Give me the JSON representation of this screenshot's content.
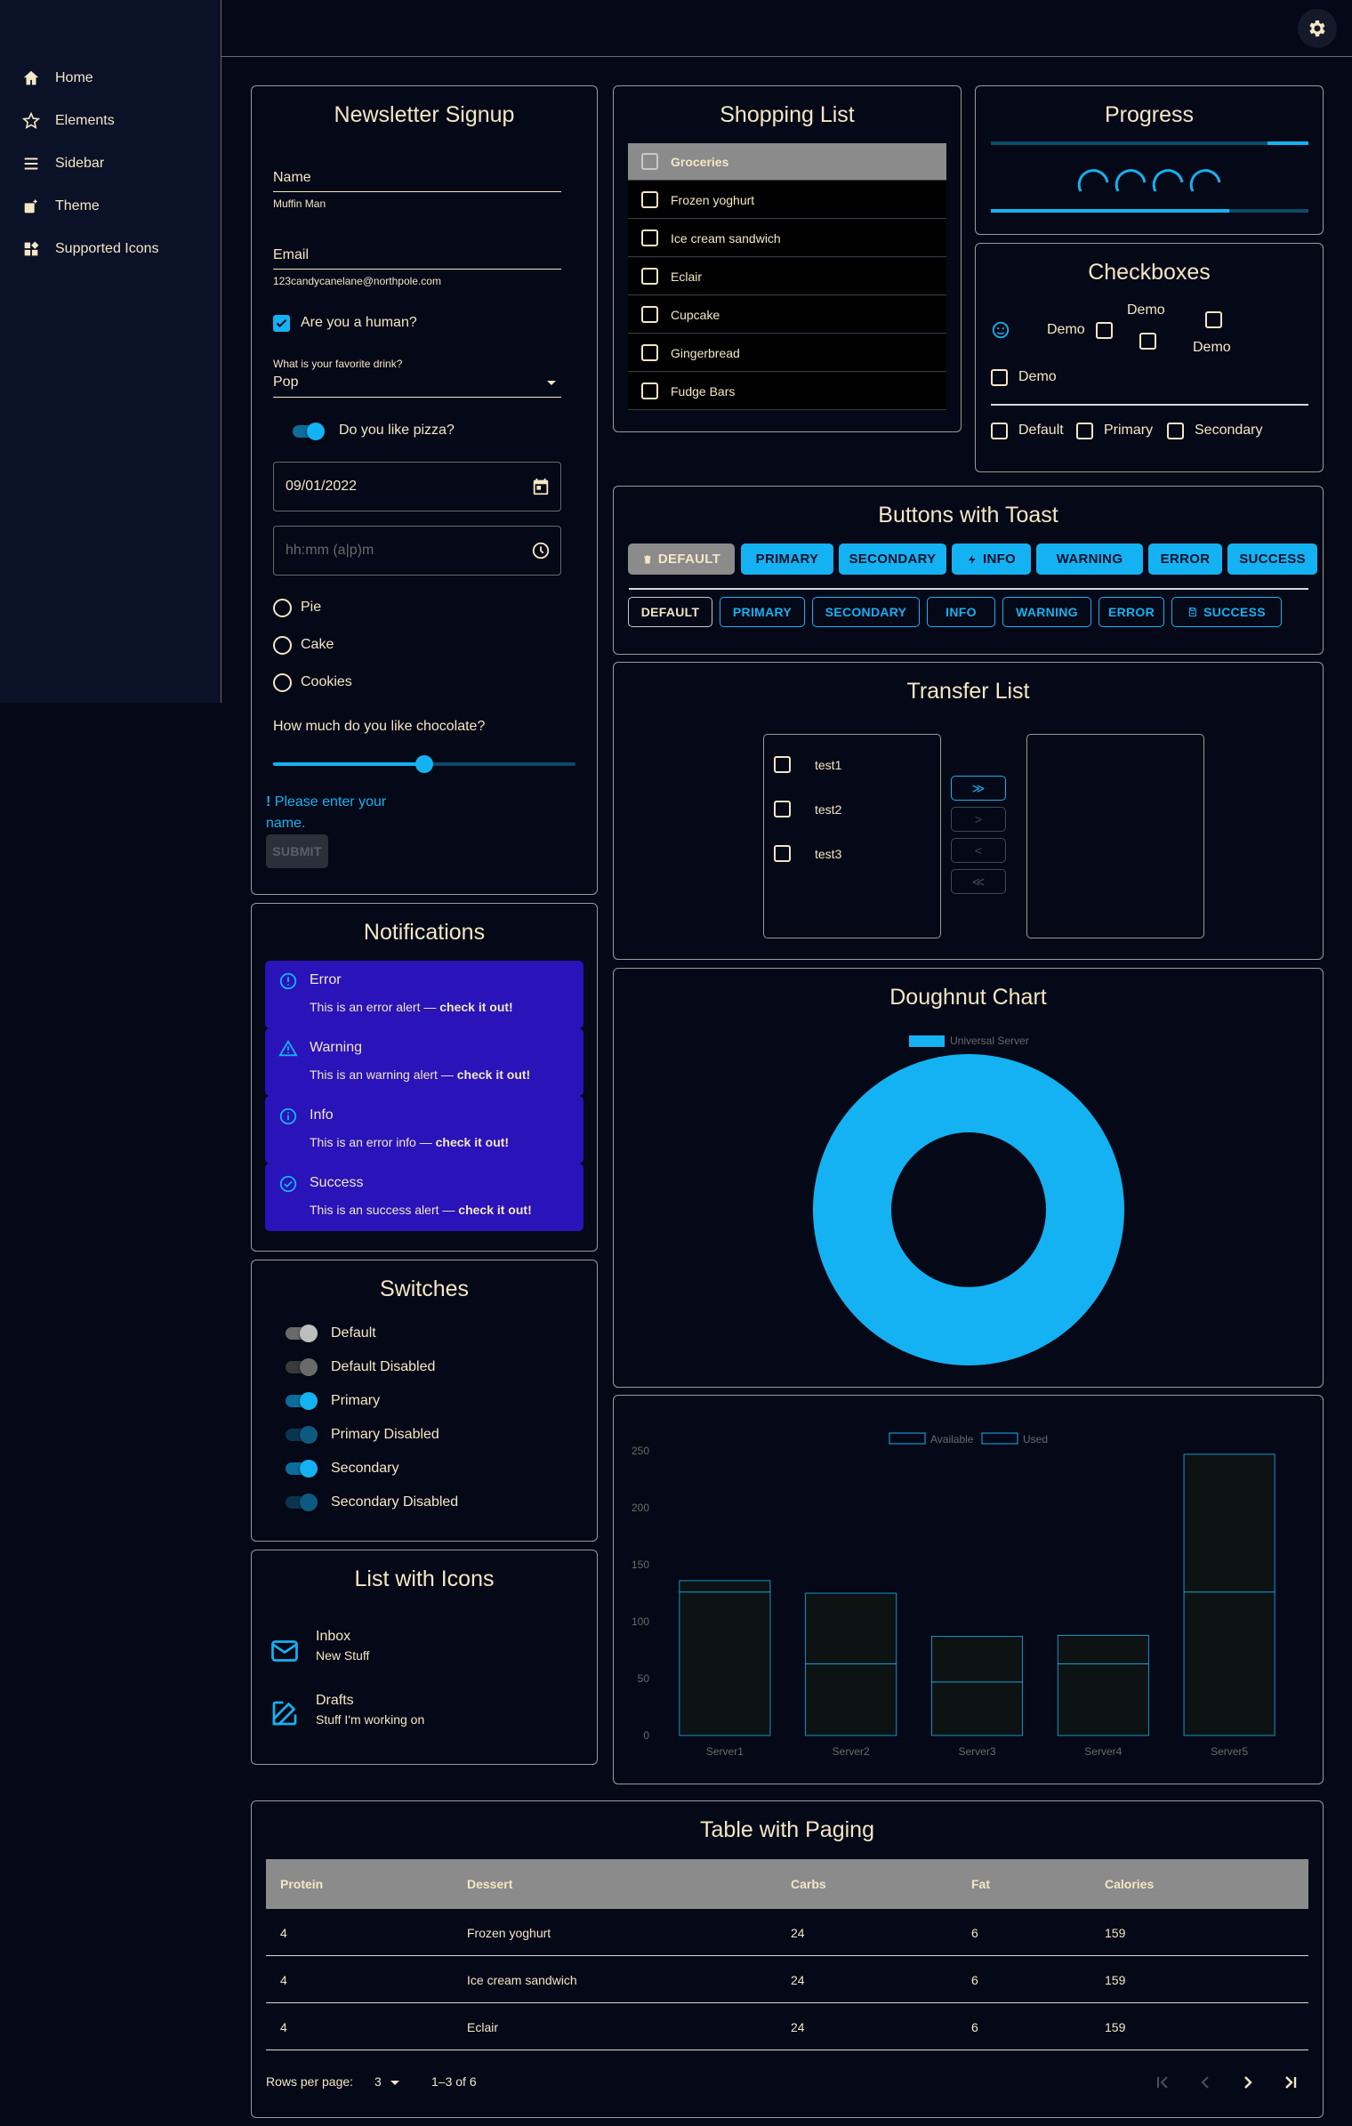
{
  "sidebar": {
    "items": [
      {
        "label": "Home",
        "icon": "home-icon"
      },
      {
        "label": "Elements",
        "icon": "star-icon"
      },
      {
        "label": "Sidebar",
        "icon": "menu-icon"
      },
      {
        "label": "Theme",
        "icon": "theme-icon"
      },
      {
        "label": "Supported Icons",
        "icon": "widgets-icon"
      }
    ]
  },
  "header": {
    "settings_icon": "gear-icon"
  },
  "newsletter": {
    "title": "Newsletter Signup",
    "name_label": "Name",
    "name_value": "Muffin Man",
    "email_label": "Email",
    "email_value": "123candycanelane@northpole.com",
    "human_label": "Are you a human?",
    "human_checked": true,
    "drink_label": "What is your favorite drink?",
    "drink_value": "Pop",
    "pizza_label": "Do you like pizza?",
    "pizza_on": true,
    "date_value": "09/01/2022",
    "time_placeholder": "hh:mm (a|p)m",
    "radios": [
      "Pie",
      "Cake",
      "Cookies"
    ],
    "slider_label": "How much do you like chocolate?",
    "slider_value": 0.5,
    "error_icon": "!",
    "error_text": "Please enter your name.",
    "submit_label": "SUBMIT"
  },
  "shopping": {
    "title": "Shopping List",
    "items": [
      "Groceries",
      "Frozen yoghurt",
      "Ice cream sandwich",
      "Eclair",
      "Cupcake",
      "Gingerbread",
      "Fudge Bars"
    ]
  },
  "progress": {
    "title": "Progress",
    "bar1_value": 0.13,
    "bar2_value": 0.75
  },
  "checkboxes": {
    "title": "Checkboxes",
    "demo": "Demo",
    "row2": [
      "Default",
      "Primary",
      "Secondary"
    ]
  },
  "buttons": {
    "title": "Buttons with Toast",
    "contained": [
      "DEFAULT",
      "PRIMARY",
      "SECONDARY",
      "INFO",
      "WARNING",
      "ERROR",
      "SUCCESS"
    ],
    "outlined": [
      "DEFAULT",
      "PRIMARY",
      "SECONDARY",
      "INFO",
      "WARNING",
      "ERROR",
      "SUCCESS"
    ]
  },
  "transfer": {
    "title": "Transfer List",
    "left": [
      "test1",
      "test2",
      "test3"
    ],
    "buttons": [
      "≫",
      ">",
      "<",
      "≪"
    ]
  },
  "notifications": {
    "title": "Notifications",
    "alerts": [
      {
        "title": "Error",
        "text": "This is an error alert — ",
        "bold": "check it out!"
      },
      {
        "title": "Warning",
        "text": "This is an warning alert — ",
        "bold": "check it out!"
      },
      {
        "title": "Info",
        "text": "This is an error info — ",
        "bold": "check it out!"
      },
      {
        "title": "Success",
        "text": "This is an success alert — ",
        "bold": "check it out!"
      }
    ]
  },
  "switches": {
    "title": "Switches",
    "items": [
      "Default",
      "Default Disabled",
      "Primary",
      "Primary Disabled",
      "Secondary",
      "Secondary Disabled"
    ]
  },
  "icon_list": {
    "title": "List with Icons",
    "items": [
      {
        "primary": "Inbox",
        "secondary": "New Stuff",
        "icon": "mail-icon"
      },
      {
        "primary": "Drafts",
        "secondary": "Stuff I'm working on",
        "icon": "edit-icon"
      }
    ]
  },
  "doughnut": {
    "title": "Doughnut Chart",
    "legend": "Universal Server",
    "color": "#14b2f2"
  },
  "table": {
    "title": "Table with Paging",
    "headers": [
      "Protein",
      "Dessert",
      "Carbs",
      "Fat",
      "Calories"
    ],
    "rows": [
      [
        "4",
        "Frozen yoghurt",
        "24",
        "6",
        "159"
      ],
      [
        "4",
        "Ice cream sandwich",
        "24",
        "6",
        "159"
      ],
      [
        "4",
        "Eclair",
        "24",
        "6",
        "159"
      ]
    ],
    "rows_per_page_label": "Rows per page:",
    "rows_per_page": "3",
    "range": "1–3 of 6"
  },
  "chart_data": [
    {
      "type": "pie",
      "categories": [
        "Universal Server"
      ],
      "values": [
        100
      ],
      "title": "Doughnut Chart"
    },
    {
      "type": "bar",
      "categories": [
        "Server1",
        "Server2",
        "Server3",
        "Server4",
        "Server5"
      ],
      "series": [
        {
          "name": "Used",
          "values": [
            126,
            63,
            47,
            63,
            126
          ]
        },
        {
          "name": "Available",
          "values": [
            10,
            62,
            40,
            25,
            121
          ]
        }
      ],
      "stacked": true,
      "ylim": [
        0,
        250
      ],
      "yticks": [
        0,
        50,
        100,
        150,
        200,
        250
      ]
    }
  ]
}
